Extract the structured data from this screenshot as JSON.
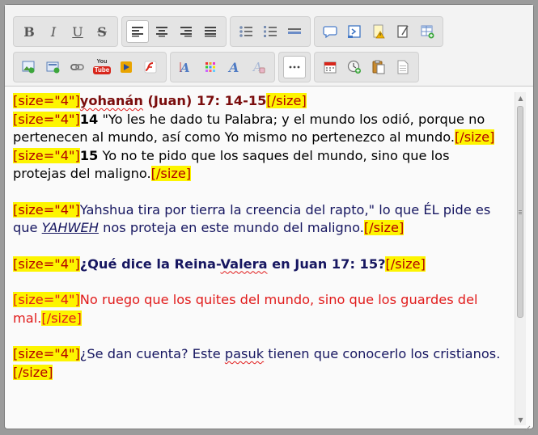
{
  "toolbar": {
    "row1": [
      {
        "group": "text-style",
        "buttons": [
          {
            "name": "bold-button",
            "label": "B"
          },
          {
            "name": "italic-button",
            "label": "I"
          },
          {
            "name": "underline-button",
            "label": "U"
          },
          {
            "name": "strikethrough-button",
            "label": "S"
          }
        ]
      },
      {
        "group": "alignment",
        "buttons": [
          {
            "name": "align-left-button",
            "icon": "align-left-icon",
            "active": true
          },
          {
            "name": "align-center-button",
            "icon": "align-center-icon"
          },
          {
            "name": "align-right-button",
            "icon": "align-right-icon"
          },
          {
            "name": "align-justify-button",
            "icon": "align-justify-icon"
          }
        ]
      },
      {
        "group": "lists",
        "buttons": [
          {
            "name": "bulleted-list-button",
            "icon": "bulleted-list-icon"
          },
          {
            "name": "numbered-list-button",
            "icon": "numbered-list-icon"
          },
          {
            "name": "horizontal-rule-button",
            "icon": "horizontal-rule-icon"
          }
        ]
      },
      {
        "group": "insert",
        "buttons": [
          {
            "name": "quote-button",
            "icon": "speech-bubble-icon"
          },
          {
            "name": "code-button",
            "icon": "code-icon"
          },
          {
            "name": "spoiler-button",
            "icon": "warning-note-icon"
          },
          {
            "name": "note-button",
            "icon": "note-icon"
          },
          {
            "name": "table-button",
            "icon": "table-add-icon"
          }
        ]
      }
    ],
    "row2": [
      {
        "group": "media",
        "buttons": [
          {
            "name": "image-button",
            "icon": "image-icon"
          },
          {
            "name": "attachment-button",
            "icon": "attachment-icon"
          },
          {
            "name": "link-button",
            "icon": "link-icon"
          },
          {
            "name": "youtube-button",
            "icon": "youtube-icon",
            "label_top": "You",
            "label_bottom": "Tube"
          },
          {
            "name": "video-button",
            "icon": "video-icon"
          },
          {
            "name": "flash-button",
            "icon": "flash-icon"
          }
        ]
      },
      {
        "group": "font",
        "buttons": [
          {
            "name": "font-size-button",
            "icon": "font-size-icon"
          },
          {
            "name": "font-color-button",
            "icon": "color-palette-icon"
          },
          {
            "name": "font-face-button",
            "icon": "font-face-icon"
          },
          {
            "name": "remove-format-button",
            "icon": "remove-format-icon"
          }
        ]
      },
      {
        "group": "more",
        "buttons": [
          {
            "name": "more-button",
            "icon": "more-icon",
            "active": true
          }
        ]
      },
      {
        "group": "misc",
        "buttons": [
          {
            "name": "date-button",
            "icon": "calendar-icon"
          },
          {
            "name": "time-button",
            "icon": "clock-add-icon"
          },
          {
            "name": "paste-button",
            "icon": "paste-icon"
          },
          {
            "name": "source-button",
            "icon": "document-icon"
          }
        ]
      }
    ]
  },
  "editor": {
    "p1": {
      "l1_tag_open": "[size=\"4\"]",
      "l1_text_a": "yohanán",
      "l1_text_b": " ",
      "l1_text_c": "(Juan) 17: 14-15",
      "l1_tag_close": "[/size]",
      "l2_tag_open": "[size=\"4\"]",
      "l2_num": "14",
      "l2_text": " \"Yo les he dado tu Palabra; y el mundo los odió, porque no pertenecen al mundo, así como Yo mismo no pertenezco al mundo.",
      "l2_tag_close": "[/size]",
      "l3_tag_open": "[size=\"4\"]",
      "l3_num": "15",
      "l3_text": " Yo no te pido que los saques del mundo, sino que los protejas del maligno.",
      "l3_tag_close": "[/size]"
    },
    "p2": {
      "tag_open": "[size=\"4\"]",
      "text_a": "Yahshua tira por tierra la creencia del rapto,\" lo que ÉL pide es que ",
      "yahweh": "YAHWEH",
      "text_b": " nos proteja en este mundo del maligno.",
      "tag_close": "[/size]"
    },
    "p3": {
      "tag_open": "[size=\"4\"]",
      "text_a": "¿Qué dice la Reina-",
      "valera": "Valera",
      "text_b": " en Juan 17: 15?",
      "tag_close": "[/size]"
    },
    "p4": {
      "tag_open": "[size=\"4\"]",
      "text": "No ruego que los quites del mundo, sino que los guardes del mal.",
      "tag_close": "[/size]"
    },
    "p5": {
      "tag_open": "[size=\"4\"]",
      "text_a": "¿Se dan cuenta? Este ",
      "pasuk": "pasuk",
      "text_b": " tienen que conocerlo los cristianos.",
      "tag_close": "[/size]"
    }
  },
  "colors": {
    "tag_highlight": "#fdf500",
    "tag_text": "#b30000",
    "maroon": "#7a0d0d",
    "navy": "#161660",
    "red": "#e11b1b"
  }
}
